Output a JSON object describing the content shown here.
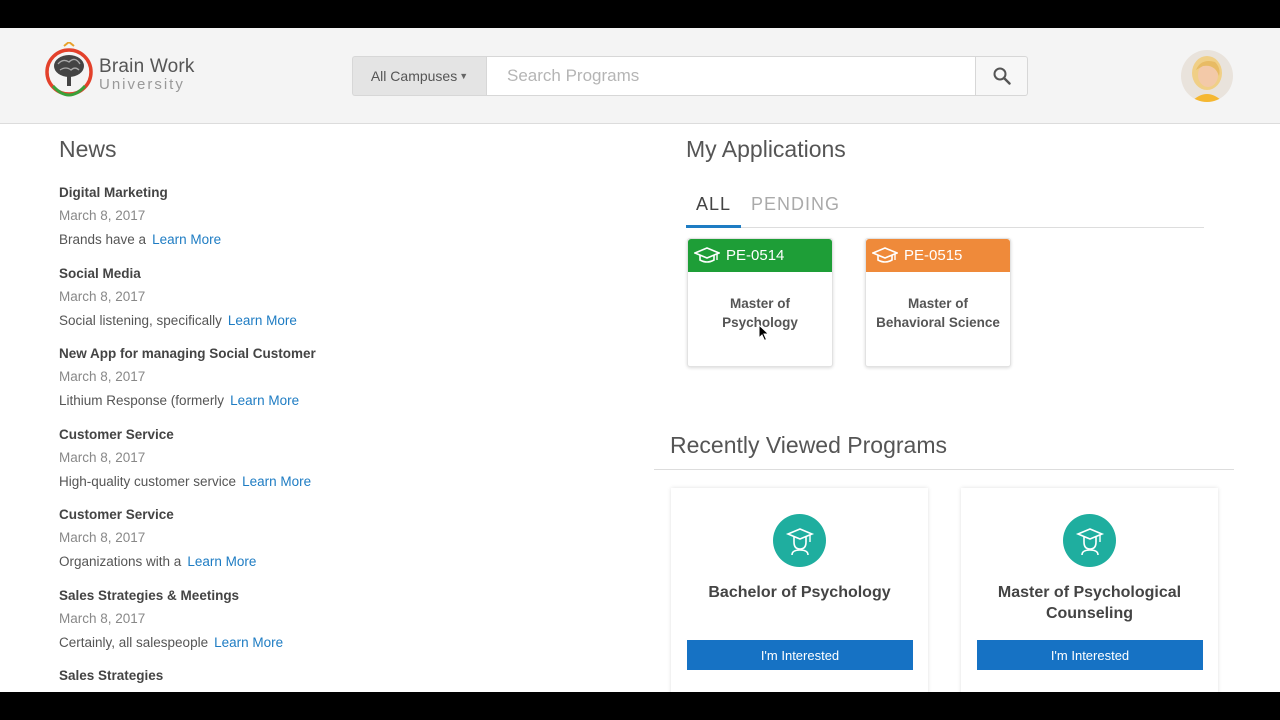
{
  "header": {
    "logo": {
      "name": "Brain Work",
      "sub": "University"
    },
    "search": {
      "campus_label": "All Campuses",
      "placeholder": "Search Programs"
    },
    "icons": {
      "search": "search-icon",
      "avatar": "user-avatar"
    }
  },
  "news": {
    "title": "News",
    "learn_more": "Learn More",
    "items": [
      {
        "title": "Digital Marketing",
        "date": "March 8, 2017",
        "excerpt": "Brands have a"
      },
      {
        "title": "Social Media",
        "date": "March 8, 2017",
        "excerpt": "Social listening, specifically"
      },
      {
        "title": "New App for managing Social Customer",
        "date": "March 8, 2017",
        "excerpt": "Lithium Response (formerly"
      },
      {
        "title": "Customer Service",
        "date": "March 8, 2017",
        "excerpt": "High-quality customer service"
      },
      {
        "title": "Customer Service",
        "date": "March 8, 2017",
        "excerpt": "Organizations with a"
      },
      {
        "title": "Sales Strategies & Meetings",
        "date": "March 8, 2017",
        "excerpt": "Certainly, all salespeople"
      },
      {
        "title": "Sales Strategies",
        "date": "",
        "excerpt": ""
      }
    ]
  },
  "applications": {
    "title": "My Applications",
    "tabs": [
      {
        "label": "ALL",
        "active": true
      },
      {
        "label": "PENDING",
        "active": false
      }
    ],
    "cards": [
      {
        "code": "PE-0514",
        "program": "Master of Psychology",
        "color": "#1e9e37"
      },
      {
        "code": "PE-0515",
        "program": "Master of Behavioral Science",
        "color": "#ef8a3a"
      }
    ]
  },
  "recent": {
    "title": "Recently Viewed Programs",
    "button_label": "I'm Interested",
    "programs": [
      {
        "name": "Bachelor of Psychology"
      },
      {
        "name": "Master of Psychological Counseling"
      }
    ]
  },
  "colors": {
    "accent": "#1e7cc3",
    "button": "#1672c4",
    "teal": "#1fae9f"
  }
}
